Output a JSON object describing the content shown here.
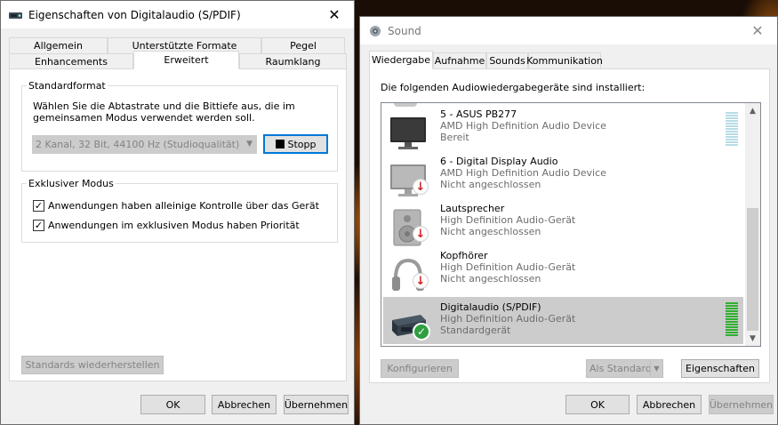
{
  "win1": {
    "title": "Eigenschaften von Digitalaudio (S/PDIF)",
    "close": "✕",
    "tabs_row1": [
      "Allgemein",
      "Unterstützte Formate",
      "Pegel"
    ],
    "tabs_row2": [
      "Enhancements",
      "Erweitert",
      "Raumklang"
    ],
    "active_tab": "Erweitert",
    "standardformat": {
      "label": "Standardformat",
      "description_line1": "Wählen Sie die Abtastrate und die Bittiefe aus, die im",
      "description_line2": "gemeinsamen Modus verwendet werden soll.",
      "combo_value": "2 Kanal, 32 Bit, 44100 Hz (Studioqualität)",
      "stop_button": "Stopp"
    },
    "exklusiv": {
      "label": "Exklusiver Modus",
      "opt1": "Anwendungen haben alleinige Kontrolle über das Gerät",
      "opt1_checked": true,
      "opt2": "Anwendungen im exklusiven Modus haben Priorität",
      "opt2_checked": true
    },
    "restore_button": "Standards wiederherstellen",
    "ok": "OK",
    "cancel": "Abbrechen",
    "apply": "Übernehmen"
  },
  "win2": {
    "title": "Sound",
    "close": "✕",
    "tabs": [
      "Wiedergabe",
      "Aufnahme",
      "Sounds",
      "Kommunikation"
    ],
    "active_tab": "Wiedergabe",
    "intro": "Die folgenden Audiowiedergabegeräte sind installiert:",
    "devices": [
      {
        "name": "5 - ASUS PB277",
        "desc": "AMD High Definition Audio Device",
        "status": "Bereit",
        "icon": "monitor-icon",
        "badge": ""
      },
      {
        "name": "6 - Digital Display Audio",
        "desc": "AMD High Definition Audio Device",
        "status": "Nicht angeschlossen",
        "icon": "monitor-icon",
        "badge": "disconnected"
      },
      {
        "name": "Lautsprecher",
        "desc": "High Definition Audio-Gerät",
        "status": "Nicht angeschlossen",
        "icon": "speaker-icon",
        "badge": "disconnected"
      },
      {
        "name": "Kopfhörer",
        "desc": "High Definition Audio-Gerät",
        "status": "Nicht angeschlossen",
        "icon": "headphones-icon",
        "badge": "disconnected"
      },
      {
        "name": "Digitalaudio (S/PDIF)",
        "desc": "High Definition Audio-Gerät",
        "status": "Standardgerät",
        "icon": "digital-audio-icon",
        "badge": "default"
      }
    ],
    "configure_button": "Konfigurieren",
    "default_button": "Als Standard",
    "properties_button": "Eigenschaften",
    "ok": "OK",
    "cancel": "Abbrechen",
    "apply": "Übernehmen"
  },
  "colors": {
    "accent": "#0078d7",
    "meter_idle": "#b7dce6",
    "meter_active": "#30b030",
    "selected_row": "#cccccc"
  }
}
